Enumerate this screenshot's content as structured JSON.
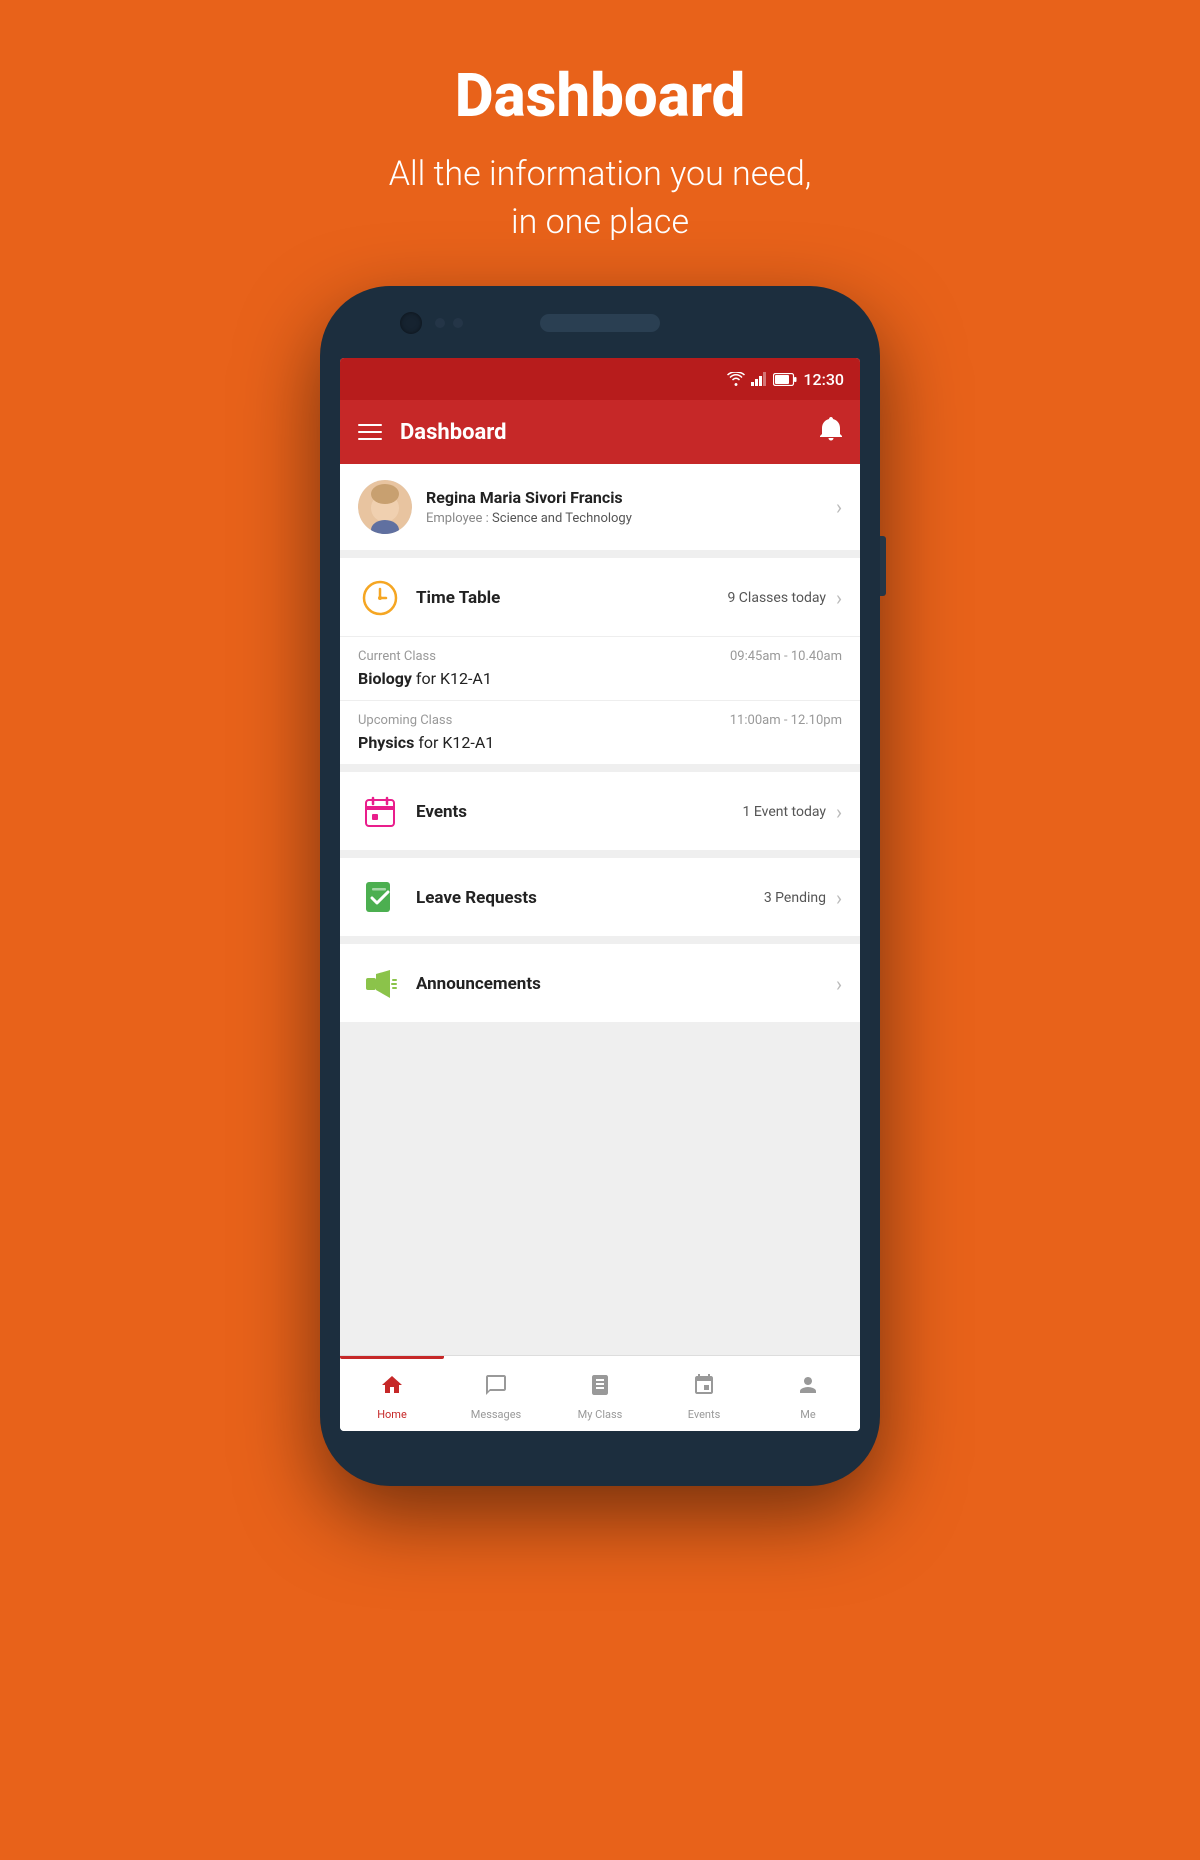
{
  "page": {
    "title": "Dashboard",
    "subtitle_line1": "All the information you need,",
    "subtitle_line2": "in one place"
  },
  "status_bar": {
    "time": "12:30"
  },
  "app_bar": {
    "title": "Dashboard",
    "menu_label": "Menu",
    "notification_label": "Notifications"
  },
  "user": {
    "name": "Regina Maria Sivori Francis",
    "role_label": "Employee :",
    "department": "Science and Technology"
  },
  "timetable_card": {
    "title": "Time Table",
    "badge": "9 Classes today",
    "current_class": {
      "label": "Current Class",
      "time": "09:45am - 10.40am",
      "subject": "Biology",
      "group": "for K12-A1"
    },
    "upcoming_class": {
      "label": "Upcoming Class",
      "time": "11:00am - 12.10pm",
      "subject": "Physics",
      "group": "for K12-A1"
    }
  },
  "events_card": {
    "title": "Events",
    "badge": "1 Event today"
  },
  "leave_card": {
    "title": "Leave Requests",
    "badge": "3 Pending"
  },
  "announcements_card": {
    "title": "Announcements",
    "badge": ""
  },
  "bottom_nav": {
    "items": [
      {
        "id": "home",
        "label": "Home",
        "active": true
      },
      {
        "id": "messages",
        "label": "Messages",
        "active": false
      },
      {
        "id": "myclass",
        "label": "My Class",
        "active": false
      },
      {
        "id": "events",
        "label": "Events",
        "active": false
      },
      {
        "id": "me",
        "label": "Me",
        "active": false
      }
    ]
  }
}
